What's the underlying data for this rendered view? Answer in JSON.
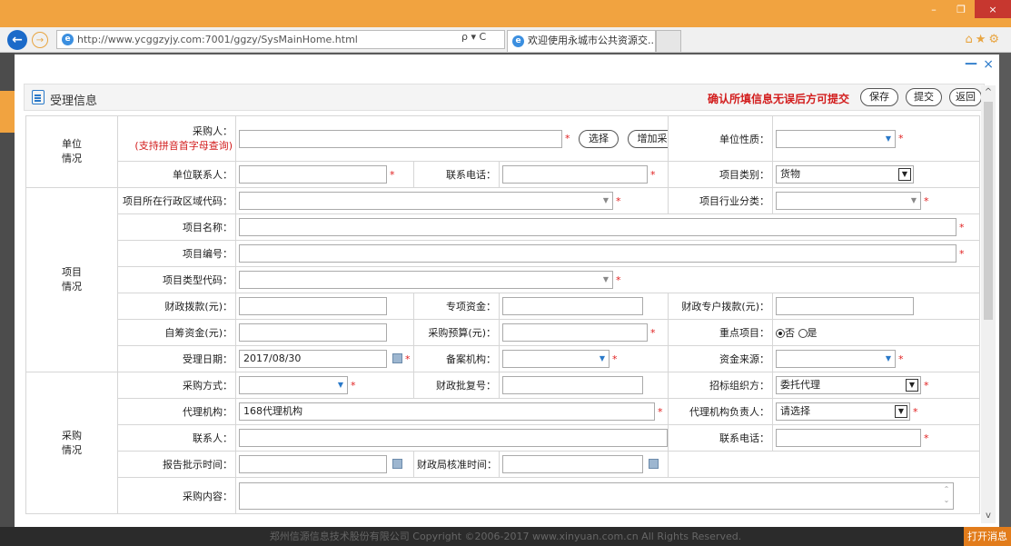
{
  "browser": {
    "url": "http://www.ycggzyjy.com:7001/ggzy/SysMainHome.html",
    "address_buttons": "ρ ▾ C",
    "tab_title": "欢迎使用永城市公共资源交...",
    "tab_close": "×",
    "back_glyph": "←",
    "forward_glyph": "→",
    "toolbar_icons": "⌂★⚙"
  },
  "window": {
    "minimize": "–",
    "maximize": "❐",
    "close": "×"
  },
  "modal": {
    "close": "×",
    "minimize": "—"
  },
  "header": {
    "title": "受理信息",
    "warning": "确认所填信息无误后方可提交",
    "save": "保存",
    "submit": "提交",
    "back": "返回"
  },
  "sections": {
    "unit": "单位\n情况",
    "project": "项目\n情况",
    "purchase": "采购\n情况"
  },
  "unit": {
    "buyer_label": "采购人：",
    "buyer_hint": "(支持拼音首字母查询)",
    "select_btn": "选择",
    "add_buyer_btn": "增加采购人",
    "unit_nature_label": "单位性质：",
    "contact_label": "单位联系人：",
    "phone_label": "联系电话：",
    "category_label": "项目类别：",
    "category_value": "货物"
  },
  "project": {
    "region_label": "项目所在行政区域代码：",
    "industry_label": "项目行业分类：",
    "name_label": "项目名称：",
    "code_label": "项目编号：",
    "type_code_label": "项目类型代码：",
    "finance_label": "财政拨款(元)：",
    "special_fund_label": "专项资金：",
    "special_account_label": "财政专户拨款(元)：",
    "self_fund_label": "自筹资金(元)：",
    "budget_label": "采购预算(元)：",
    "key_project_label": "重点项目：",
    "key_no": "否",
    "key_yes": "是",
    "accept_date_label": "受理日期：",
    "accept_date_value": "2017/08/30",
    "record_org_label": "备案机构：",
    "fund_source_label": "资金来源："
  },
  "purchase": {
    "method_label": "采购方式：",
    "approval_label": "财政批复号：",
    "organizer_label": "招标组织方：",
    "organizer_value": "委托代理",
    "agency_label": "代理机构：",
    "agency_value": "168代理机构",
    "agency_head_label": "代理机构负责人：",
    "agency_head_value": "请选择",
    "contact_label": "联系人：",
    "phone_label": "联系电话：",
    "report_time_label": "报告批示时间：",
    "finance_time_label": "财政局核准时间：",
    "content_label": "采购内容："
  },
  "footer": {
    "copyright": "郑州信源信息技术股份有限公司 Copyright ©2006-2017 www.xinyuan.com.cn All Rights Reserved.",
    "message_btn": "打开消息"
  },
  "colors": {
    "accent": "#2a79c9",
    "warning": "#d21c1c",
    "brand_orange": "#f1a340"
  }
}
